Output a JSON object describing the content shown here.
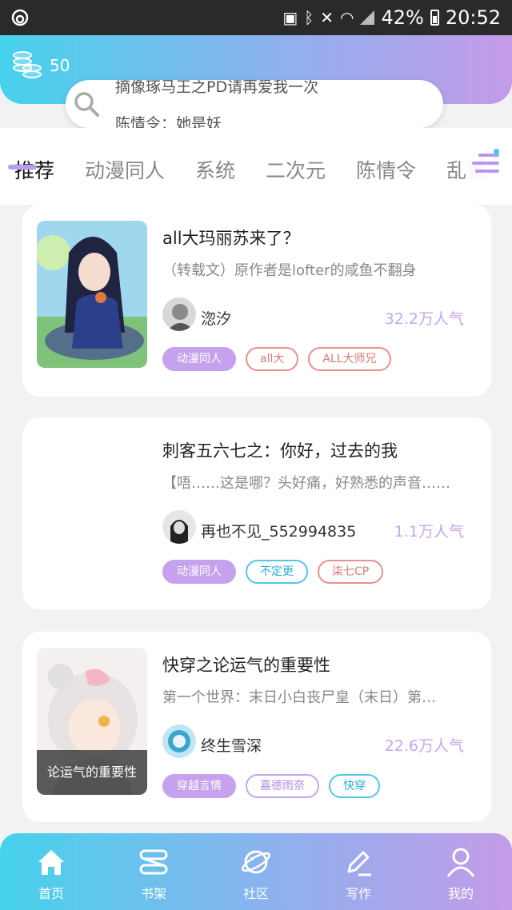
{
  "status_bar": {
    "battery": "42%",
    "time": "20:52"
  },
  "header": {
    "coin_count": "50"
  },
  "search": {
    "ticker_prev": "摘像琢马王之PD请再爱我一次",
    "ticker_current": "陈情令：她是妖"
  },
  "tabs": [
    {
      "label": "推荐",
      "active": true
    },
    {
      "label": "动漫同人"
    },
    {
      "label": "系统"
    },
    {
      "label": "二次元"
    },
    {
      "label": "陈情令"
    },
    {
      "label": "乱黄"
    }
  ],
  "stories": [
    {
      "title": "all大玛丽苏来了？",
      "desc": "（转载文）原作者是lofter的咸鱼不翻身",
      "author": "淴汐",
      "popularity": "32.2万人气",
      "tags": [
        {
          "label": "动漫同人",
          "style": "filled"
        },
        {
          "label": "all大",
          "style": "red"
        },
        {
          "label": "ALL大师兄",
          "style": "red"
        }
      ]
    },
    {
      "title": "刺客五六七之：你好，过去的我",
      "desc": "【唔……这是哪？头好痛，好熟悉的声音……",
      "author": "再也不见_552994835",
      "popularity": "1.1万人气",
      "tags": [
        {
          "label": "动漫同人",
          "style": "filled"
        },
        {
          "label": "不定更",
          "style": "cyan"
        },
        {
          "label": "柒七CP",
          "style": "red"
        }
      ]
    },
    {
      "title": "快穿之论运气的重要性",
      "desc": "第一个世界：末日小白丧尸皇（末日）第…",
      "author": "终生雪深",
      "popularity": "22.6万人气",
      "cover_caption": "论运气的重要性",
      "tags": [
        {
          "label": "穿越言情",
          "style": "filled"
        },
        {
          "label": "嘉德雨奈",
          "style": "purple"
        },
        {
          "label": "快穿",
          "style": "cyan"
        }
      ]
    }
  ],
  "bottom_nav": [
    {
      "label": "首页",
      "icon": "home-icon"
    },
    {
      "label": "书架",
      "icon": "bookshelf-icon"
    },
    {
      "label": "社区",
      "icon": "planet-icon"
    },
    {
      "label": "写作",
      "icon": "pen-icon"
    },
    {
      "label": "我的",
      "icon": "user-icon"
    }
  ],
  "colors": {
    "gradient_start": "#46d2ec",
    "gradient_end": "#c49be8",
    "accent_purple": "#c6a2ee",
    "popularity": "#c5a6ee"
  }
}
